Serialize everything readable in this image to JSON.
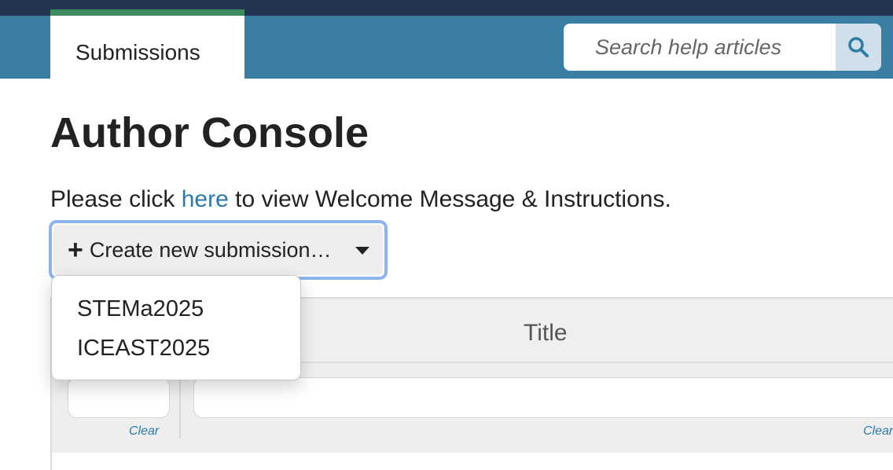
{
  "nav": {
    "active_tab": "Submissions",
    "search_placeholder": "Search help articles",
    "search_icon": "search-icon"
  },
  "page": {
    "title": "Author Console",
    "welcome_before": "Please click ",
    "welcome_link": "here",
    "welcome_after": " to view Welcome Message & Instructions."
  },
  "create": {
    "plus_icon": "+",
    "label": "Create new submission…"
  },
  "dropdown": {
    "items": [
      "STEMa2025",
      "ICEAST2025"
    ]
  },
  "table": {
    "header_title": "Title",
    "clear_label": "Clear"
  },
  "colors": {
    "top_strip": "#243554",
    "navbar": "#3a7fa3",
    "active_tab_accent": "#3f8a5e",
    "link": "#2d7aa6",
    "focus_ring": "#8db4ee"
  }
}
